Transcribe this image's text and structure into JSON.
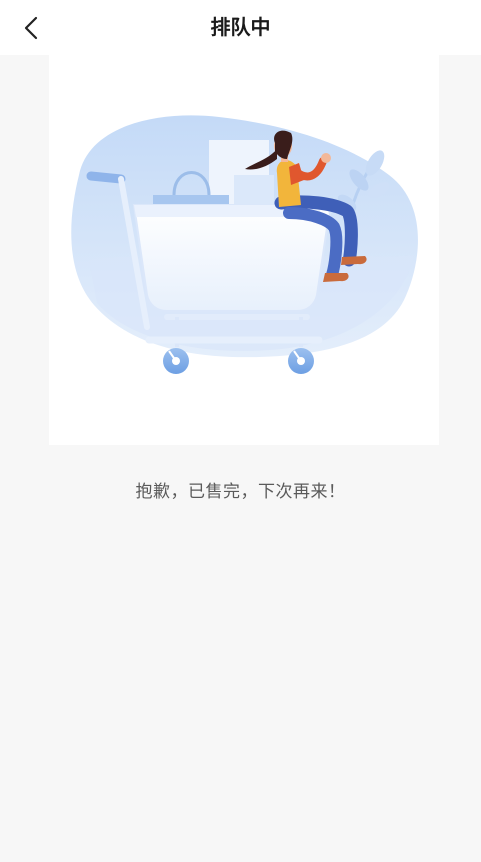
{
  "header": {
    "title": "排队中",
    "back_icon": "chevron-left-icon"
  },
  "illustration": {
    "name": "woman-in-shopping-cart-illustration",
    "accent_color": "#bdd5f5"
  },
  "main": {
    "message": "抱歉，已售完，下次再来！"
  }
}
